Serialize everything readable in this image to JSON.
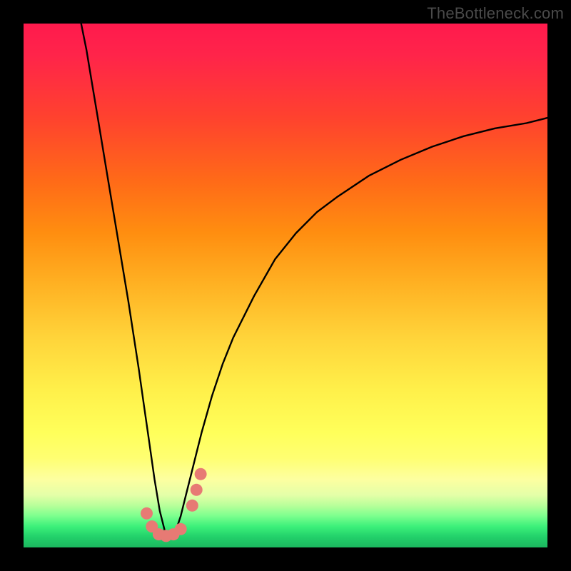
{
  "watermark": "TheBottleneck.com",
  "colors": {
    "frame": "#000000",
    "curve": "#000000",
    "marker_fill": "#e77a74",
    "marker_stroke": "#d6645e"
  },
  "chart_data": {
    "type": "line",
    "title": "",
    "xlabel": "",
    "ylabel": "",
    "xlim": [
      0,
      100
    ],
    "ylim": [
      0,
      100
    ],
    "grid": false,
    "legend": false,
    "note": "Axis values are normalized 0–100 (no tick labels shown in image). y=0 is the green bottom, y=100 is the red top. Curve is a V-shape with minimum near x≈27.",
    "series": [
      {
        "name": "bottleneck-curve",
        "x": [
          11,
          12,
          13,
          14,
          15,
          16,
          18,
          20,
          22,
          23,
          24,
          25,
          26,
          27,
          28,
          29,
          30,
          31,
          32,
          33,
          34,
          36,
          38,
          40,
          44,
          48,
          52,
          56,
          60,
          66,
          72,
          78,
          84,
          90,
          96,
          100
        ],
        "y": [
          100,
          95,
          89,
          83,
          77,
          71,
          59,
          47,
          34,
          27,
          20,
          13,
          7,
          3,
          2,
          3,
          6,
          10,
          14,
          18,
          22,
          29,
          35,
          40,
          48,
          55,
          60,
          64,
          67,
          71,
          74,
          76.5,
          78.5,
          80,
          81,
          82
        ]
      }
    ],
    "markers": {
      "name": "highlighted-points",
      "note": "Salmon-colored dots near the curve minimum.",
      "points": [
        {
          "x": 23.5,
          "y": 6.5
        },
        {
          "x": 24.5,
          "y": 4.0
        },
        {
          "x": 25.8,
          "y": 2.5
        },
        {
          "x": 27.2,
          "y": 2.2
        },
        {
          "x": 28.6,
          "y": 2.5
        },
        {
          "x": 30.0,
          "y": 3.5
        },
        {
          "x": 32.2,
          "y": 8.0
        },
        {
          "x": 33.0,
          "y": 11.0
        },
        {
          "x": 33.8,
          "y": 14.0
        }
      ]
    }
  }
}
